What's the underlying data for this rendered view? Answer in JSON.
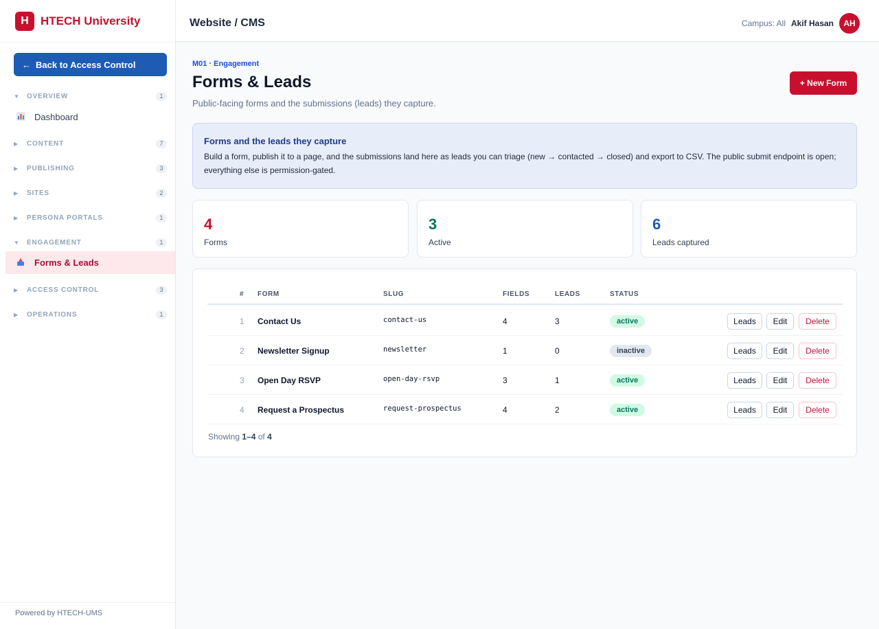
{
  "brand": {
    "logo_letter": "H",
    "name": "HTECH University",
    "color": "#c8102e"
  },
  "sidebar": {
    "back_label": "Back to Access Control",
    "back_icon": "←",
    "sections": [
      {
        "label": "OVERVIEW",
        "count": "1",
        "expanded": true
      },
      {
        "label": "CONTENT",
        "count": "7",
        "expanded": false
      },
      {
        "label": "PUBLISHING",
        "count": "3",
        "expanded": false
      },
      {
        "label": "SITES",
        "count": "2",
        "expanded": false
      },
      {
        "label": "PERSONA PORTALS",
        "count": "1",
        "expanded": false
      },
      {
        "label": "ENGAGEMENT",
        "count": "1",
        "expanded": true
      },
      {
        "label": "ACCESS CONTROL",
        "count": "3",
        "expanded": false
      },
      {
        "label": "OPERATIONS",
        "count": "1",
        "expanded": false
      }
    ],
    "items": [
      {
        "label": "Dashboard",
        "icon": "chart-icon",
        "active": false
      },
      {
        "label": "Forms & Leads",
        "icon": "form-icon",
        "active": true
      }
    ],
    "footer": "Powered by HTECH-UMS"
  },
  "header": {
    "breadcrumb": "Website / CMS",
    "campus": "Campus: All",
    "user_name": "Akif Hasan",
    "avatar_initials": "AH"
  },
  "page": {
    "kicker": "M01 · Engagement",
    "title": "Forms & Leads",
    "subtitle": "Public-facing forms and the submissions (leads) they capture.",
    "new_button": "+ New Form"
  },
  "info": {
    "heading": "Forms and the leads they capture",
    "body": "Build a form, publish it to a page, and the submissions land here as leads you can triage (new → contacted → closed) and export to CSV. The public submit endpoint is open; everything else is permission-gated."
  },
  "stats": [
    {
      "value": "4",
      "label": "Forms",
      "color": "#c8102e"
    },
    {
      "value": "3",
      "label": "Active",
      "color": "#047857"
    },
    {
      "value": "6",
      "label": "Leads captured",
      "color": "#1d5bb5"
    }
  ],
  "table": {
    "columns": [
      "#",
      "FORM",
      "SLUG",
      "FIELDS",
      "LEADS",
      "STATUS"
    ],
    "rows": [
      {
        "index": "1",
        "form": "Contact Us",
        "slug": "contact-us",
        "fields": "4",
        "leads": "3",
        "status": "active"
      },
      {
        "index": "2",
        "form": "Newsletter Signup",
        "slug": "newsletter",
        "fields": "1",
        "leads": "0",
        "status": "inactive"
      },
      {
        "index": "3",
        "form": "Open Day RSVP",
        "slug": "open-day-rsvp",
        "fields": "3",
        "leads": "1",
        "status": "active"
      },
      {
        "index": "4",
        "form": "Request a Prospectus",
        "slug": "request-prospectus",
        "fields": "4",
        "leads": "2",
        "status": "active"
      }
    ],
    "actions": {
      "leads": "Leads",
      "edit": "Edit",
      "delete": "Delete"
    },
    "showing": {
      "prefix": "Showing",
      "range": "1–4",
      "of": "of",
      "total": "4"
    }
  }
}
